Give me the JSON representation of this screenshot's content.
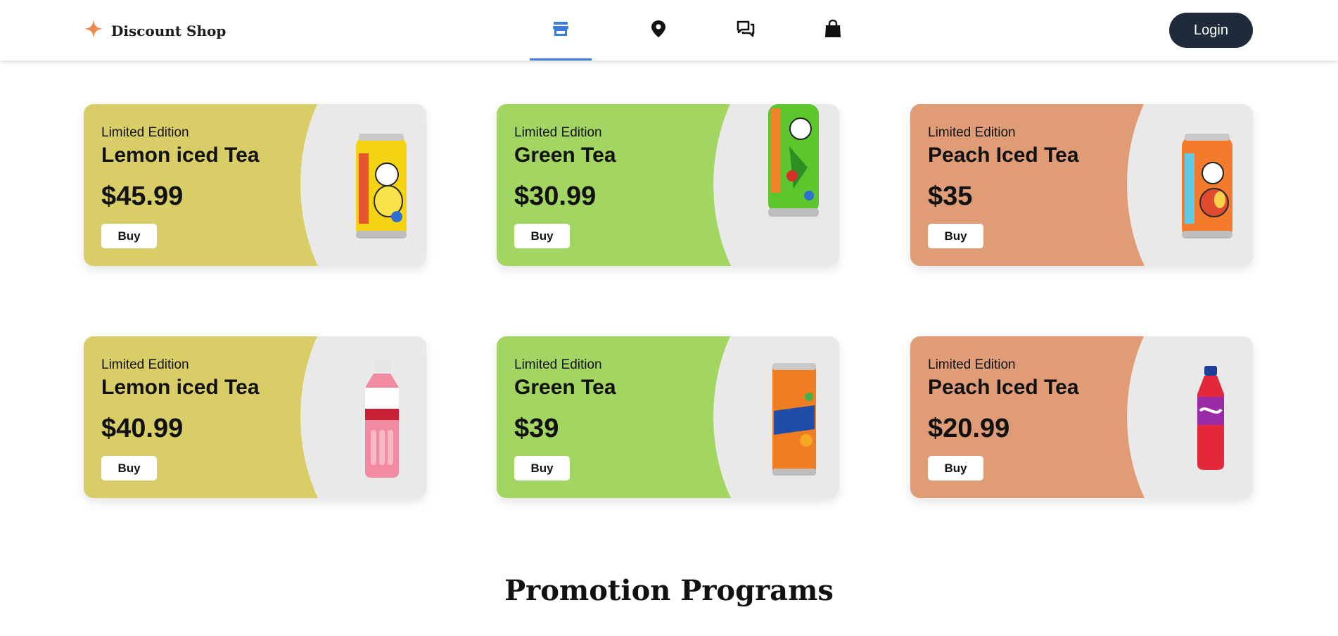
{
  "header": {
    "brand_name": "Discount Shop",
    "brand_icon": "sparkle-icon",
    "nav": [
      {
        "icon": "store-icon",
        "active": true
      },
      {
        "icon": "location-pin-icon",
        "active": false
      },
      {
        "icon": "chat-icon",
        "active": false
      },
      {
        "icon": "shopping-bag-icon",
        "active": false
      }
    ],
    "login_label": "Login"
  },
  "colors": {
    "accent": "#3b7ddd",
    "login_bg": "#1f2a3a",
    "yellow": "#d9cd68",
    "green": "#a2d561",
    "peach": "#df9c77",
    "card_right": "#e9e9e9"
  },
  "cards": [
    {
      "eyebrow": "Limited Edition",
      "title": "Lemon iced Tea",
      "price": "$45.99",
      "buy_label": "Buy",
      "theme": "yellow",
      "product": "lemon-tea-can"
    },
    {
      "eyebrow": "Limited Edition",
      "title": "Green Tea",
      "price": "$30.99",
      "buy_label": "Buy",
      "theme": "green",
      "product": "green-tea-can"
    },
    {
      "eyebrow": "Limited Edition",
      "title": "Peach Iced Tea",
      "price": "$35",
      "buy_label": "Buy",
      "theme": "peach",
      "product": "peach-tea-can"
    },
    {
      "eyebrow": "Limited Edition",
      "title": "Lemon iced Tea",
      "price": "$40.99",
      "buy_label": "Buy",
      "theme": "yellow",
      "product": "mogu-mogu-bottle"
    },
    {
      "eyebrow": "Limited Edition",
      "title": "Green Tea",
      "price": "$39",
      "buy_label": "Buy",
      "theme": "green",
      "product": "max-plus-can"
    },
    {
      "eyebrow": "Limited Edition",
      "title": "Peach Iced Tea",
      "price": "$20.99",
      "buy_label": "Buy",
      "theme": "peach",
      "product": "sunkist-bottle"
    }
  ],
  "section_title": "Promotion Programs"
}
